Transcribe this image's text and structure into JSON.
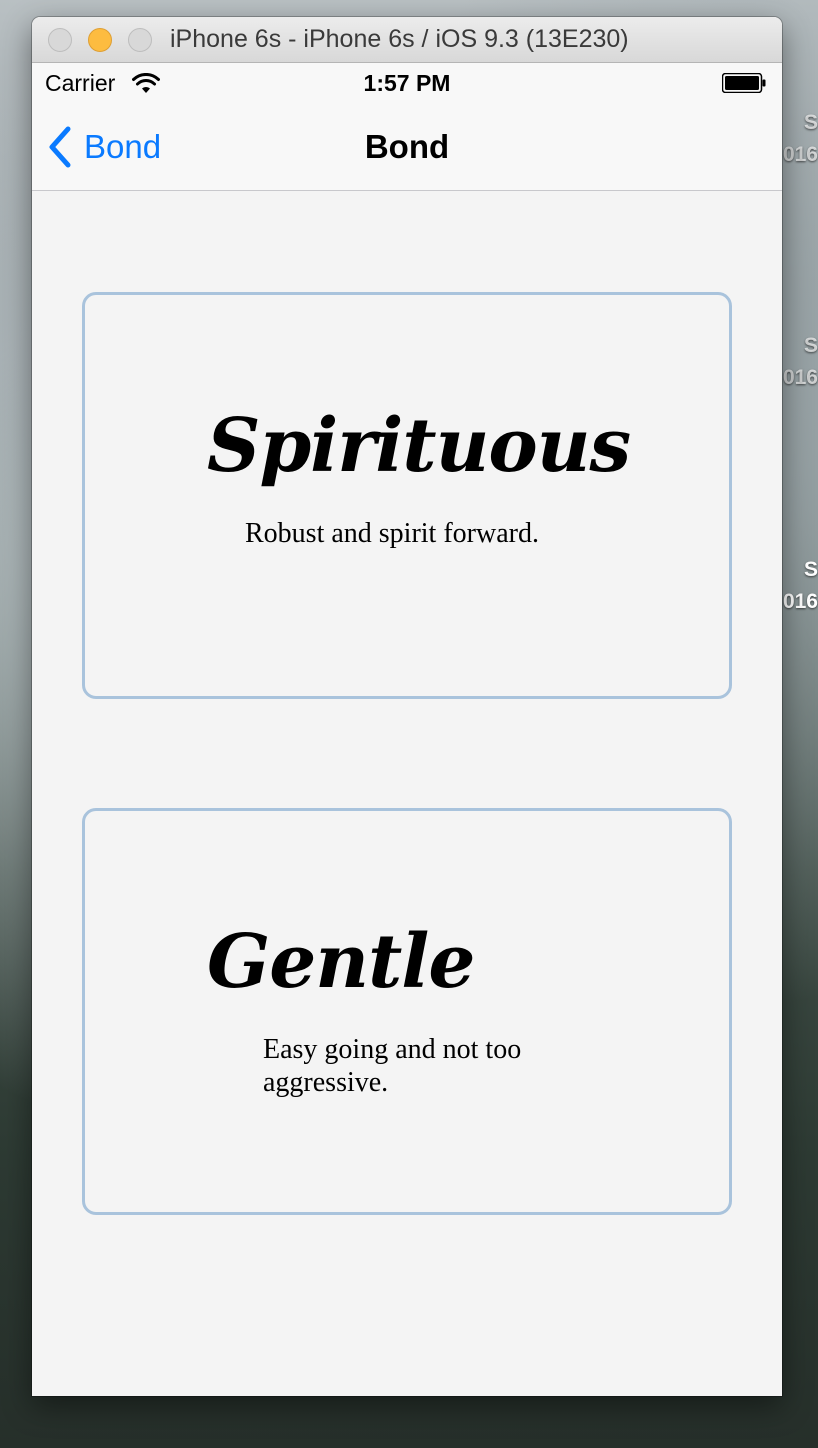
{
  "window": {
    "title": "iPhone 6s - iPhone 6s / iOS 9.3 (13E230)"
  },
  "desktop": {
    "labels": [
      {
        "line1": "S",
        "line2": "016"
      },
      {
        "line1": "S",
        "line2": "016"
      },
      {
        "line1": "S",
        "line2": "016"
      }
    ]
  },
  "status_bar": {
    "carrier": "Carrier",
    "time": "1:57 PM"
  },
  "nav": {
    "back_label": "Bond",
    "title": "Bond"
  },
  "cards": [
    {
      "title": "Spirituous",
      "description": "Robust and spirit forward."
    },
    {
      "title": "Gentle",
      "description": "Easy going and not too aggressive."
    }
  ],
  "colors": {
    "accent": "#0a7aff",
    "card_border": "#a9c3dc",
    "background": "#f4f4f4"
  }
}
